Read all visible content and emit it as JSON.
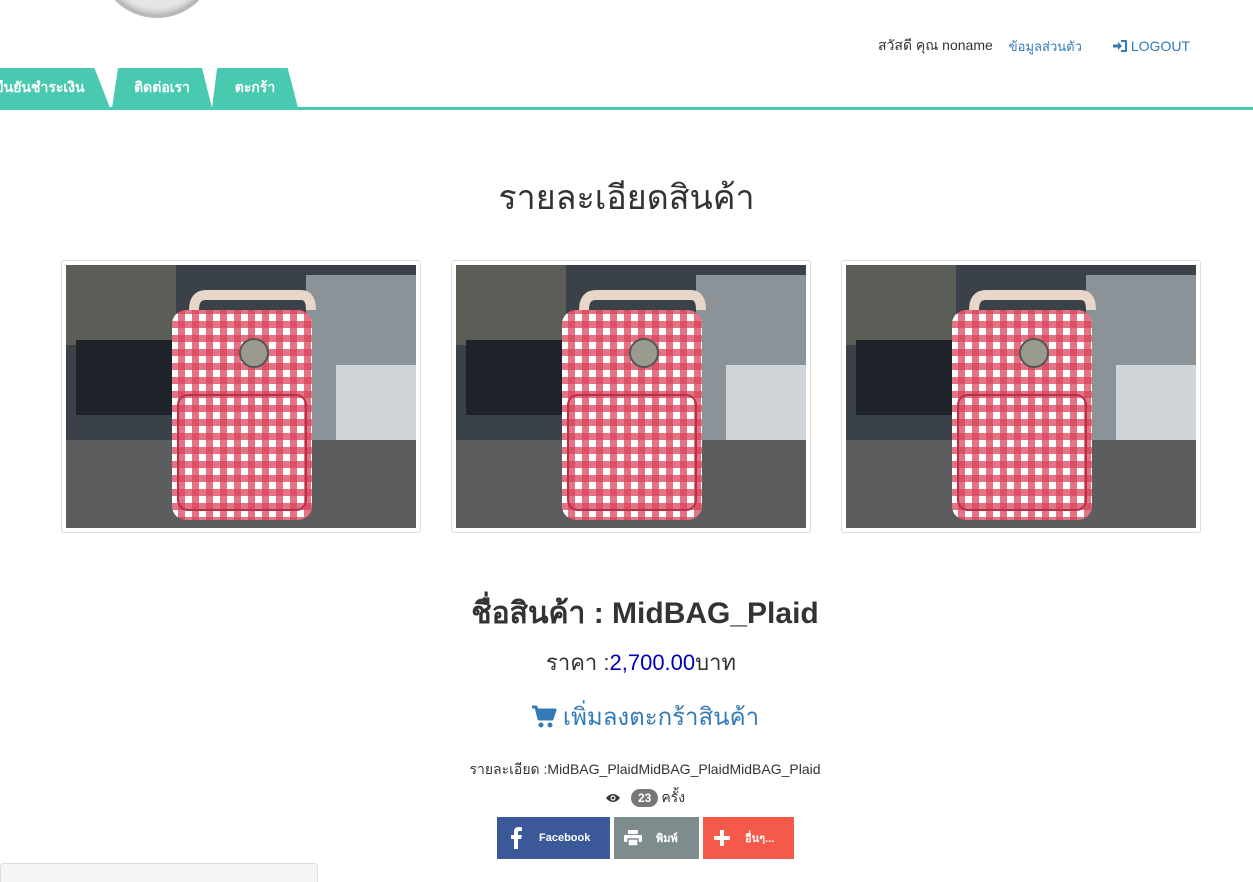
{
  "header": {
    "greeting": "สวัสดี คุณ noname",
    "profile_link": "ข้อมูลส่วนตัว",
    "logout_label": "LOGOUT"
  },
  "nav": {
    "tabs": [
      {
        "label": "ยืนยันชำระเงิน"
      },
      {
        "label": "ติดต่อเรา"
      },
      {
        "label": "ตะกร้า"
      }
    ]
  },
  "page": {
    "title": "รายละเอียดสินค้า"
  },
  "product": {
    "name_label": "ชื่อสินค้า : MidBAG_Plaid",
    "price_prefix": "ราคา :",
    "price_value": "2,700.00",
    "price_unit": "บาท",
    "add_to_cart": "เพิ่มลงตะกร้าสินค้า",
    "description": "รายละเอียด :MidBAG_PlaidMidBAG_PlaidMidBAG_Plaid",
    "view_count": "23",
    "view_unit": "ครั้ง",
    "image_count": 3
  },
  "share": {
    "facebook": "Facebook",
    "print": "พิมพ์",
    "more": "อื่นๆ..."
  },
  "colors": {
    "tab_green": "#48c9b0",
    "link_blue": "#337ab7",
    "price_blue": "#0000bb",
    "facebook": "#3b5998",
    "print": "#7f8c8d",
    "more": "#f4594a"
  }
}
